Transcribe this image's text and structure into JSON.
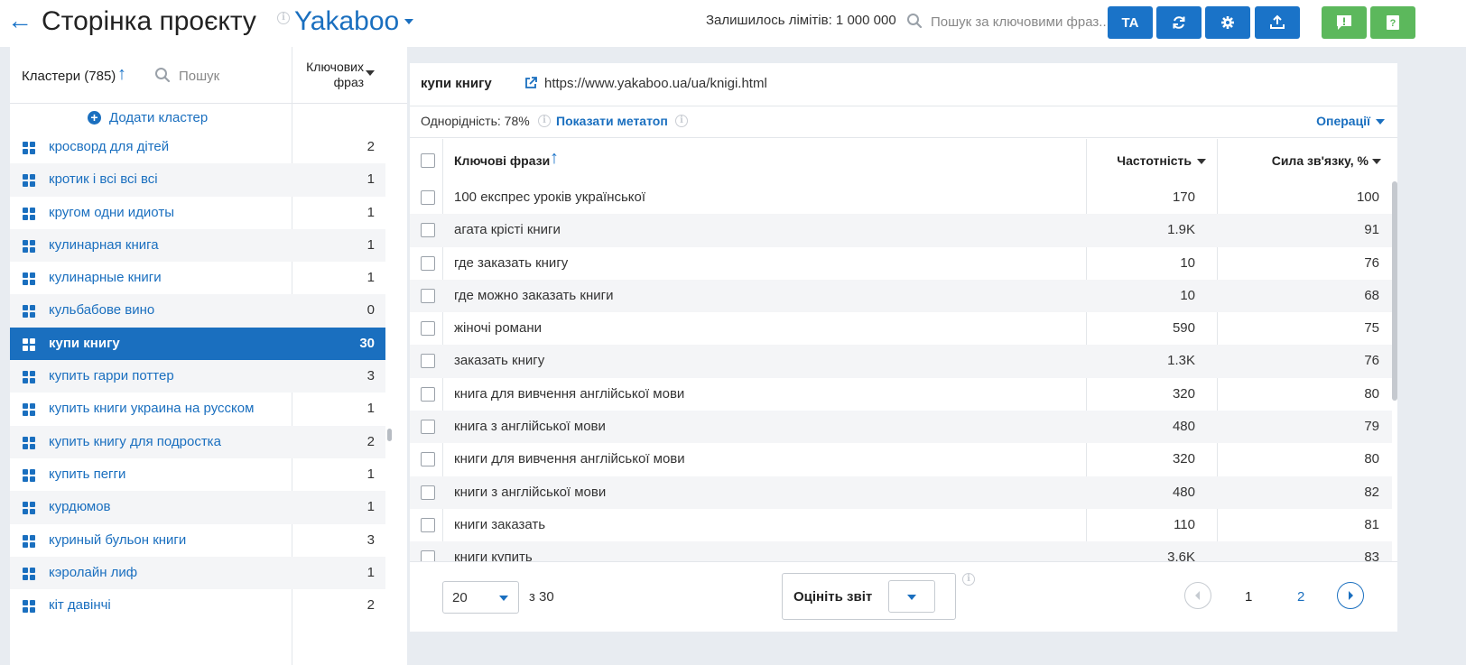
{
  "header": {
    "title": "Сторінка проєкту",
    "project": "Yakaboo",
    "limits": "Залишилось лімітів: 1 000 000",
    "search_placeholder": "Пошук за ключовими фраз...",
    "buttons": {
      "ta": "ТА"
    }
  },
  "sidebar": {
    "title": "Кластери (785)",
    "search_placeholder": "Пошук",
    "count_header": "Ключових фраз",
    "add_cluster": "Додати кластер",
    "items": [
      {
        "name": "кросворд для дітей",
        "count": "2"
      },
      {
        "name": "кротик і всі всі всі",
        "count": "1"
      },
      {
        "name": "кругом одни идиоты",
        "count": "1"
      },
      {
        "name": "кулинарная книга",
        "count": "1"
      },
      {
        "name": "кулинарные книги",
        "count": "1"
      },
      {
        "name": "кульбабове вино",
        "count": "0"
      },
      {
        "name": "купи книгу",
        "count": "30"
      },
      {
        "name": "купить гарри поттер",
        "count": "3"
      },
      {
        "name": "купить книги украина на русском",
        "count": "1"
      },
      {
        "name": "купить книгу для подростка",
        "count": "2"
      },
      {
        "name": "купить пегги",
        "count": "1"
      },
      {
        "name": "курдюмов",
        "count": "1"
      },
      {
        "name": "куриный бульон книги",
        "count": "3"
      },
      {
        "name": "кэролайн лиф",
        "count": "1"
      },
      {
        "name": "кіт давінчі",
        "count": "2"
      }
    ],
    "active_index": 6
  },
  "main": {
    "cluster": "купи книгу",
    "url": "https://www.yakaboo.ua/ua/knigi.html",
    "homogeneity": "Однорідність: 78%",
    "show_meta": "Показати метатоп",
    "operations": "Операції",
    "columns": {
      "phrase": "Ключові фрази",
      "freq": "Частотність",
      "relation": "Сила зв'язку, %"
    },
    "rows": [
      {
        "phrase": "100 експрес уроків української",
        "freq": "170",
        "rel": "100"
      },
      {
        "phrase": "агата крісті книги",
        "freq": "1.9K",
        "rel": "91"
      },
      {
        "phrase": "где заказать книгу",
        "freq": "10",
        "rel": "76"
      },
      {
        "phrase": "где можно заказать книги",
        "freq": "10",
        "rel": "68"
      },
      {
        "phrase": "жіночі романи",
        "freq": "590",
        "rel": "75"
      },
      {
        "phrase": "заказать книгу",
        "freq": "1.3K",
        "rel": "76"
      },
      {
        "phrase": "книга для вивчення англійської мови",
        "freq": "320",
        "rel": "80"
      },
      {
        "phrase": "книга з англійської мови",
        "freq": "480",
        "rel": "79"
      },
      {
        "phrase": "книги для вивчення англійської мови",
        "freq": "320",
        "rel": "80"
      },
      {
        "phrase": "книги з англійської мови",
        "freq": "480",
        "rel": "82"
      },
      {
        "phrase": "книги заказать",
        "freq": "110",
        "rel": "81"
      },
      {
        "phrase": "книги купить",
        "freq": "3.6K",
        "rel": "83"
      }
    ],
    "footer": {
      "per_page": "20",
      "of_total": "з 30",
      "rate_label": "Оцініть звіт",
      "pages": [
        "1",
        "2"
      ],
      "current_page": "1"
    }
  },
  "colors": {
    "accent": "#1a73c8",
    "link": "#1a6fbf",
    "green": "#5cb85c",
    "background": "#e8ecf1"
  }
}
